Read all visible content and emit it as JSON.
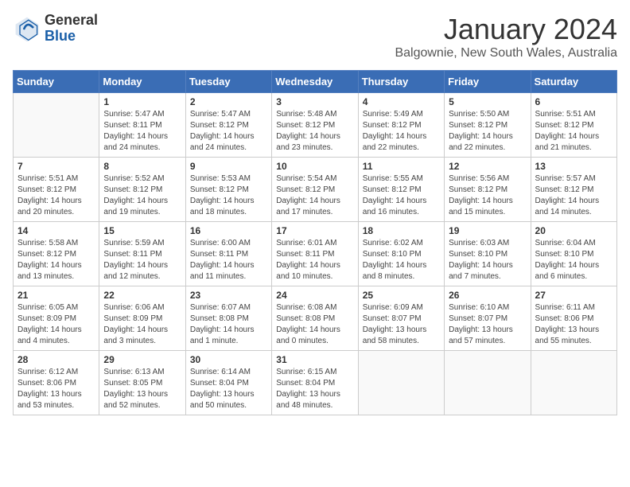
{
  "logo": {
    "general": "General",
    "blue": "Blue"
  },
  "header": {
    "month": "January 2024",
    "location": "Balgownie, New South Wales, Australia"
  },
  "weekdays": [
    "Sunday",
    "Monday",
    "Tuesday",
    "Wednesday",
    "Thursday",
    "Friday",
    "Saturday"
  ],
  "weeks": [
    [
      {
        "day": "",
        "sunrise": "",
        "sunset": "",
        "daylight": ""
      },
      {
        "day": "1",
        "sunrise": "Sunrise: 5:47 AM",
        "sunset": "Sunset: 8:11 PM",
        "daylight": "Daylight: 14 hours and 24 minutes."
      },
      {
        "day": "2",
        "sunrise": "Sunrise: 5:47 AM",
        "sunset": "Sunset: 8:12 PM",
        "daylight": "Daylight: 14 hours and 24 minutes."
      },
      {
        "day": "3",
        "sunrise": "Sunrise: 5:48 AM",
        "sunset": "Sunset: 8:12 PM",
        "daylight": "Daylight: 14 hours and 23 minutes."
      },
      {
        "day": "4",
        "sunrise": "Sunrise: 5:49 AM",
        "sunset": "Sunset: 8:12 PM",
        "daylight": "Daylight: 14 hours and 22 minutes."
      },
      {
        "day": "5",
        "sunrise": "Sunrise: 5:50 AM",
        "sunset": "Sunset: 8:12 PM",
        "daylight": "Daylight: 14 hours and 22 minutes."
      },
      {
        "day": "6",
        "sunrise": "Sunrise: 5:51 AM",
        "sunset": "Sunset: 8:12 PM",
        "daylight": "Daylight: 14 hours and 21 minutes."
      }
    ],
    [
      {
        "day": "7",
        "sunrise": "Sunrise: 5:51 AM",
        "sunset": "Sunset: 8:12 PM",
        "daylight": "Daylight: 14 hours and 20 minutes."
      },
      {
        "day": "8",
        "sunrise": "Sunrise: 5:52 AM",
        "sunset": "Sunset: 8:12 PM",
        "daylight": "Daylight: 14 hours and 19 minutes."
      },
      {
        "day": "9",
        "sunrise": "Sunrise: 5:53 AM",
        "sunset": "Sunset: 8:12 PM",
        "daylight": "Daylight: 14 hours and 18 minutes."
      },
      {
        "day": "10",
        "sunrise": "Sunrise: 5:54 AM",
        "sunset": "Sunset: 8:12 PM",
        "daylight": "Daylight: 14 hours and 17 minutes."
      },
      {
        "day": "11",
        "sunrise": "Sunrise: 5:55 AM",
        "sunset": "Sunset: 8:12 PM",
        "daylight": "Daylight: 14 hours and 16 minutes."
      },
      {
        "day": "12",
        "sunrise": "Sunrise: 5:56 AM",
        "sunset": "Sunset: 8:12 PM",
        "daylight": "Daylight: 14 hours and 15 minutes."
      },
      {
        "day": "13",
        "sunrise": "Sunrise: 5:57 AM",
        "sunset": "Sunset: 8:12 PM",
        "daylight": "Daylight: 14 hours and 14 minutes."
      }
    ],
    [
      {
        "day": "14",
        "sunrise": "Sunrise: 5:58 AM",
        "sunset": "Sunset: 8:12 PM",
        "daylight": "Daylight: 14 hours and 13 minutes."
      },
      {
        "day": "15",
        "sunrise": "Sunrise: 5:59 AM",
        "sunset": "Sunset: 8:11 PM",
        "daylight": "Daylight: 14 hours and 12 minutes."
      },
      {
        "day": "16",
        "sunrise": "Sunrise: 6:00 AM",
        "sunset": "Sunset: 8:11 PM",
        "daylight": "Daylight: 14 hours and 11 minutes."
      },
      {
        "day": "17",
        "sunrise": "Sunrise: 6:01 AM",
        "sunset": "Sunset: 8:11 PM",
        "daylight": "Daylight: 14 hours and 10 minutes."
      },
      {
        "day": "18",
        "sunrise": "Sunrise: 6:02 AM",
        "sunset": "Sunset: 8:10 PM",
        "daylight": "Daylight: 14 hours and 8 minutes."
      },
      {
        "day": "19",
        "sunrise": "Sunrise: 6:03 AM",
        "sunset": "Sunset: 8:10 PM",
        "daylight": "Daylight: 14 hours and 7 minutes."
      },
      {
        "day": "20",
        "sunrise": "Sunrise: 6:04 AM",
        "sunset": "Sunset: 8:10 PM",
        "daylight": "Daylight: 14 hours and 6 minutes."
      }
    ],
    [
      {
        "day": "21",
        "sunrise": "Sunrise: 6:05 AM",
        "sunset": "Sunset: 8:09 PM",
        "daylight": "Daylight: 14 hours and 4 minutes."
      },
      {
        "day": "22",
        "sunrise": "Sunrise: 6:06 AM",
        "sunset": "Sunset: 8:09 PM",
        "daylight": "Daylight: 14 hours and 3 minutes."
      },
      {
        "day": "23",
        "sunrise": "Sunrise: 6:07 AM",
        "sunset": "Sunset: 8:08 PM",
        "daylight": "Daylight: 14 hours and 1 minute."
      },
      {
        "day": "24",
        "sunrise": "Sunrise: 6:08 AM",
        "sunset": "Sunset: 8:08 PM",
        "daylight": "Daylight: 14 hours and 0 minutes."
      },
      {
        "day": "25",
        "sunrise": "Sunrise: 6:09 AM",
        "sunset": "Sunset: 8:07 PM",
        "daylight": "Daylight: 13 hours and 58 minutes."
      },
      {
        "day": "26",
        "sunrise": "Sunrise: 6:10 AM",
        "sunset": "Sunset: 8:07 PM",
        "daylight": "Daylight: 13 hours and 57 minutes."
      },
      {
        "day": "27",
        "sunrise": "Sunrise: 6:11 AM",
        "sunset": "Sunset: 8:06 PM",
        "daylight": "Daylight: 13 hours and 55 minutes."
      }
    ],
    [
      {
        "day": "28",
        "sunrise": "Sunrise: 6:12 AM",
        "sunset": "Sunset: 8:06 PM",
        "daylight": "Daylight: 13 hours and 53 minutes."
      },
      {
        "day": "29",
        "sunrise": "Sunrise: 6:13 AM",
        "sunset": "Sunset: 8:05 PM",
        "daylight": "Daylight: 13 hours and 52 minutes."
      },
      {
        "day": "30",
        "sunrise": "Sunrise: 6:14 AM",
        "sunset": "Sunset: 8:04 PM",
        "daylight": "Daylight: 13 hours and 50 minutes."
      },
      {
        "day": "31",
        "sunrise": "Sunrise: 6:15 AM",
        "sunset": "Sunset: 8:04 PM",
        "daylight": "Daylight: 13 hours and 48 minutes."
      },
      {
        "day": "",
        "sunrise": "",
        "sunset": "",
        "daylight": ""
      },
      {
        "day": "",
        "sunrise": "",
        "sunset": "",
        "daylight": ""
      },
      {
        "day": "",
        "sunrise": "",
        "sunset": "",
        "daylight": ""
      }
    ]
  ]
}
